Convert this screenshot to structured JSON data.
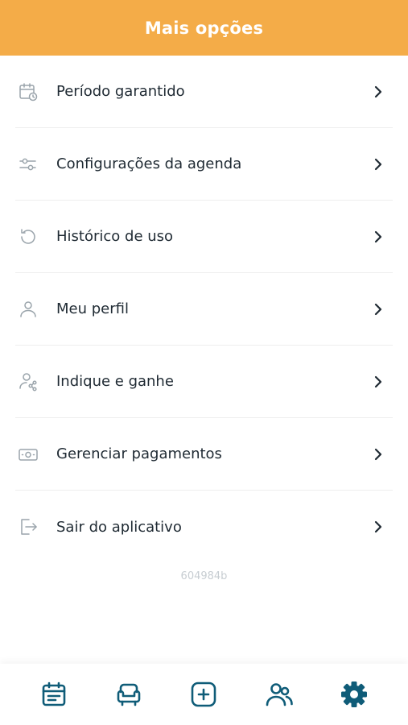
{
  "header": {
    "title": "Mais opções"
  },
  "menu": {
    "items": [
      {
        "label": "Período garantido",
        "icon": "calendar-clock-icon"
      },
      {
        "label": "Configurações da agenda",
        "icon": "sliders-icon"
      },
      {
        "label": "Histórico de uso",
        "icon": "history-icon"
      },
      {
        "label": "Meu perfil",
        "icon": "user-icon"
      },
      {
        "label": "Indique e ganhe",
        "icon": "user-share-icon"
      },
      {
        "label": "Gerenciar pagamentos",
        "icon": "money-icon"
      },
      {
        "label": "Sair do aplicativo",
        "icon": "logout-icon"
      }
    ]
  },
  "version": "604984b",
  "tabbar": {
    "tabs": [
      {
        "icon": "calendar-icon"
      },
      {
        "icon": "armchair-icon"
      },
      {
        "icon": "plus-square-icon"
      },
      {
        "icon": "users-icon"
      },
      {
        "icon": "gear-icon",
        "active": true
      }
    ]
  },
  "colors": {
    "header": "#F4AC48",
    "accent": "#0F5C78",
    "icon_muted": "#9aa4ab",
    "text": "#1f2a33"
  }
}
